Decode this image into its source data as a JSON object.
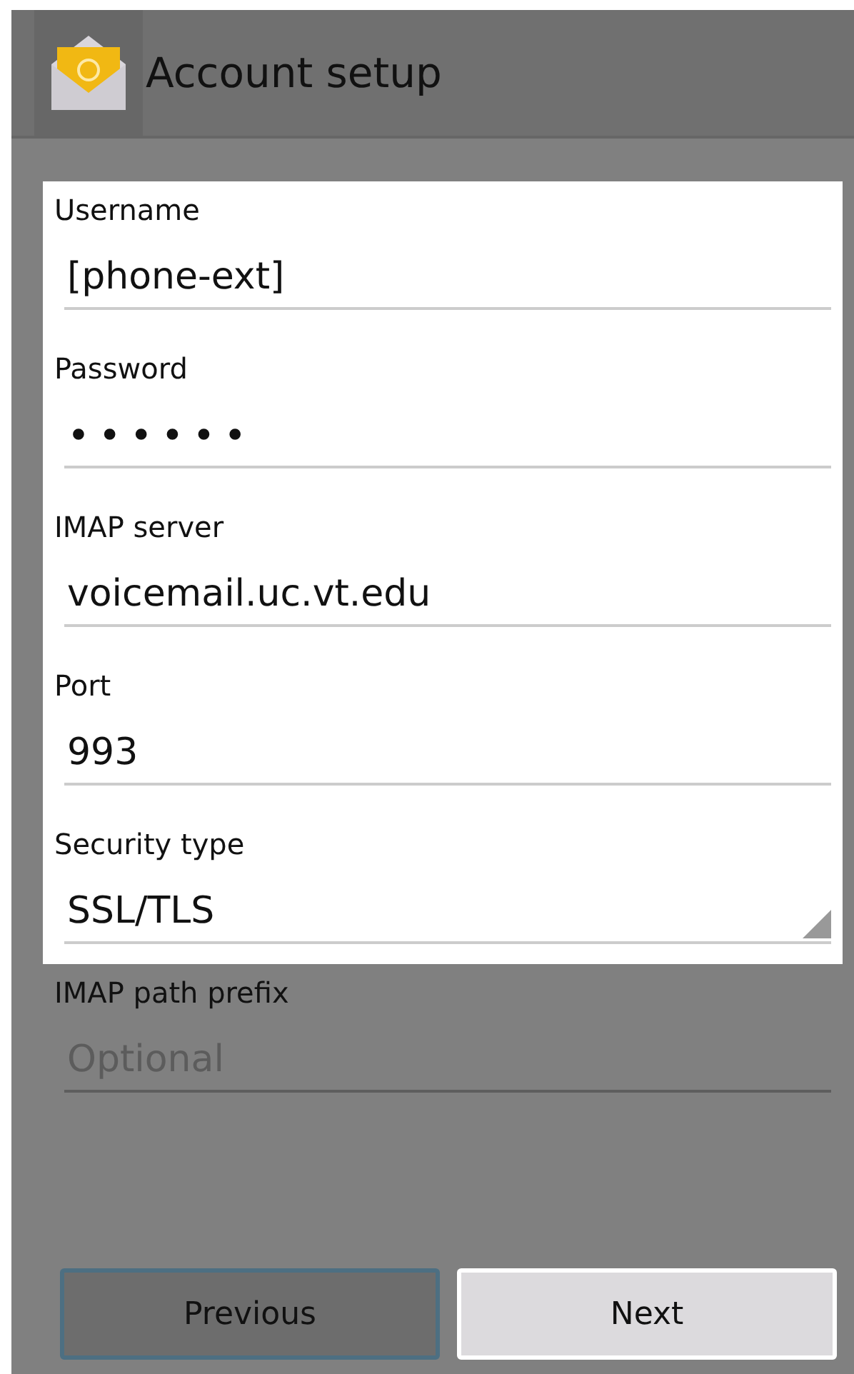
{
  "action_bar": {
    "title": "Account setup"
  },
  "fields": [
    {
      "label": "Username",
      "kind": "text",
      "value": "[phone-ext]",
      "highlighted": true
    },
    {
      "label": "Password",
      "kind": "password",
      "value": "••••••",
      "highlighted": true
    },
    {
      "label": "IMAP server",
      "kind": "text",
      "value": "voicemail.uc.vt.edu",
      "highlighted": true
    },
    {
      "label": "Port",
      "kind": "text",
      "value": "993",
      "highlighted": true
    },
    {
      "label": "Security type",
      "kind": "spinner",
      "value": "SSL/TLS",
      "highlighted": true
    },
    {
      "label": "IMAP path prefix",
      "kind": "text",
      "placeholder": "Optional",
      "highlighted": false
    }
  ],
  "buttons": [
    {
      "label": "Previous",
      "highlighted": false
    },
    {
      "label": "Next",
      "highlighted": true
    }
  ]
}
